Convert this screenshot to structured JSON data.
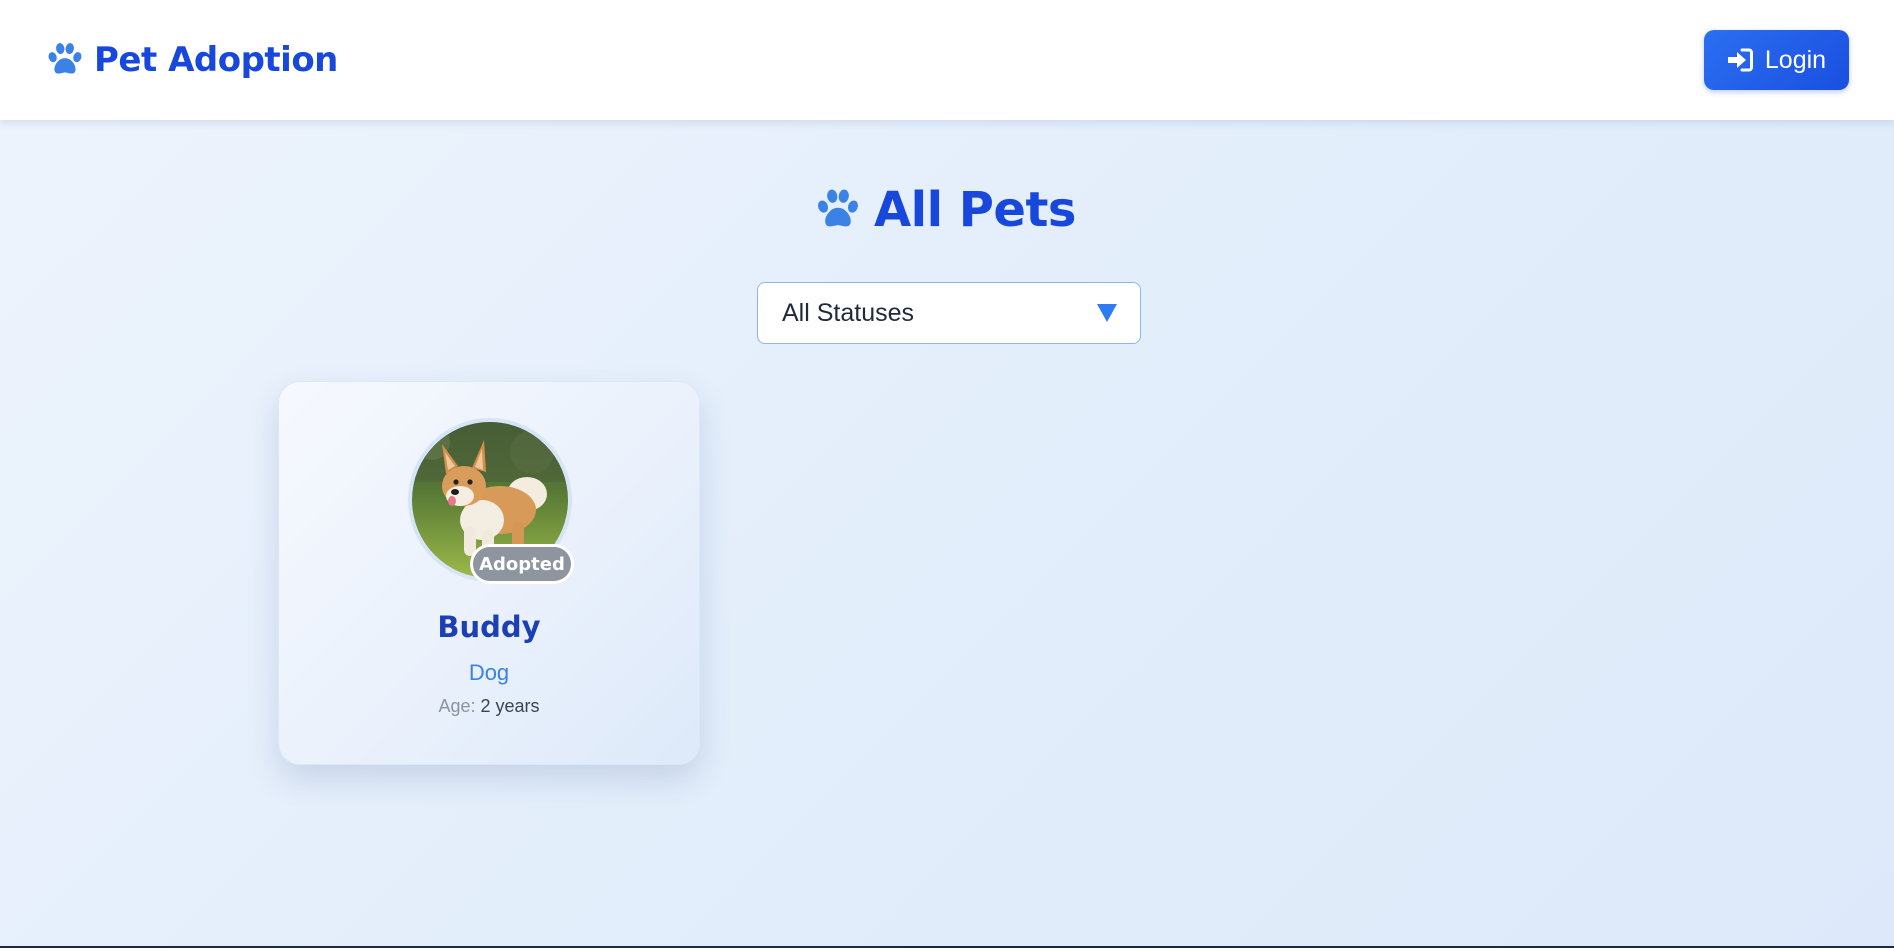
{
  "header": {
    "brand_icon": "paw-icon",
    "brand_name": "Pet Adoption",
    "login": {
      "icon": "sign-in-icon",
      "label": "Login"
    }
  },
  "main": {
    "title_icon": "paw-icon",
    "title": "All Pets",
    "status_filter": {
      "selected": "All Statuses",
      "icon": "caret-down-icon"
    },
    "pets": [
      {
        "name": "Buddy",
        "species": "Dog",
        "age_label": "Age:",
        "age_value": "2 years",
        "status": "Adopted",
        "photo": "corgi-photo"
      }
    ]
  },
  "colors": {
    "brand_blue": "#1847dc",
    "accent_blue": "#3b82e6",
    "badge_gray": "#8e959f",
    "card_name_blue": "#1d3fb4"
  }
}
